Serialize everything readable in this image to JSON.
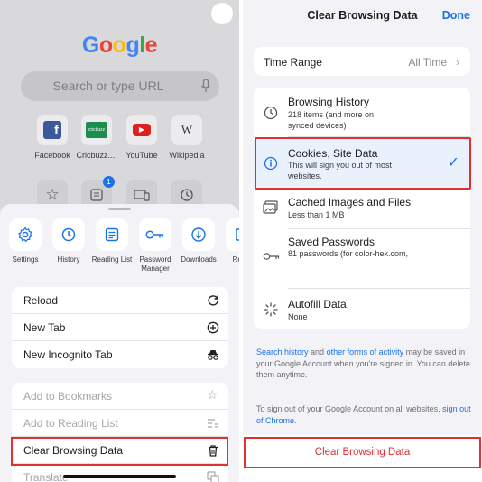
{
  "left": {
    "logo": "Google",
    "search_placeholder": "Search or type URL",
    "shortcuts": [
      {
        "label": "Facebook",
        "icon": "facebook-icon",
        "glyph": "f"
      },
      {
        "label": "Cricbuzz....",
        "icon": "cricbuzz-icon",
        "glyph": "cricbuzz"
      },
      {
        "label": "YouTube",
        "icon": "youtube-icon",
        "glyph": "▶"
      },
      {
        "label": "Wikipedia",
        "icon": "wikipedia-icon",
        "glyph": "W"
      }
    ],
    "second_row_badge": "1",
    "toolbar": [
      {
        "label": "Settings",
        "icon": "gear-icon"
      },
      {
        "label": "History",
        "icon": "history-icon"
      },
      {
        "label": "Reading List",
        "icon": "reading-list-icon"
      },
      {
        "label": "Password Manager",
        "icon": "key-icon"
      },
      {
        "label": "Downloads",
        "icon": "download-icon"
      },
      {
        "label": "Re Ta",
        "icon": "recent-tabs-icon"
      }
    ],
    "menu_group1": [
      "Reload",
      "New Tab",
      "New Incognito Tab"
    ],
    "menu_group2": [
      "Add to Bookmarks",
      "Add to Reading List",
      "Clear Browsing Data",
      "Translate"
    ]
  },
  "right": {
    "title": "Clear Browsing Data",
    "done": "Done",
    "time_range": {
      "label": "Time Range",
      "value": "All Time"
    },
    "items": [
      {
        "title": "Browsing History",
        "subtitle": "218 items (and more on synced devices)",
        "icon": "history-icon",
        "checked": false
      },
      {
        "title": "Cookies, Site Data",
        "subtitle": "This will sign you out of most websites.",
        "icon": "info-icon",
        "checked": true
      },
      {
        "title": "Cached Images and Files",
        "subtitle": "Less than 1 MB",
        "icon": "image-icon",
        "checked": false
      },
      {
        "title": "Saved Passwords",
        "subtitle": "81 passwords (for color-hex.com,",
        "icon": "key-icon",
        "checked": false
      },
      {
        "title": "Autofill Data",
        "subtitle": "None",
        "icon": "autofill-icon",
        "checked": false
      }
    ],
    "footer1": {
      "link1": "Search history",
      "text1": " and ",
      "link2": "other forms of activity",
      "text2": " may be saved in your Google Account when you're signed in. You can delete them anytime."
    },
    "footer2": {
      "text": "To sign out of your Google Account on all websites, ",
      "link": "sign out of Chrome",
      "tail": "."
    },
    "clear_button": "Clear Browsing Data"
  },
  "colors": {
    "accent": "#1a73e8",
    "highlight": "#e03030"
  }
}
